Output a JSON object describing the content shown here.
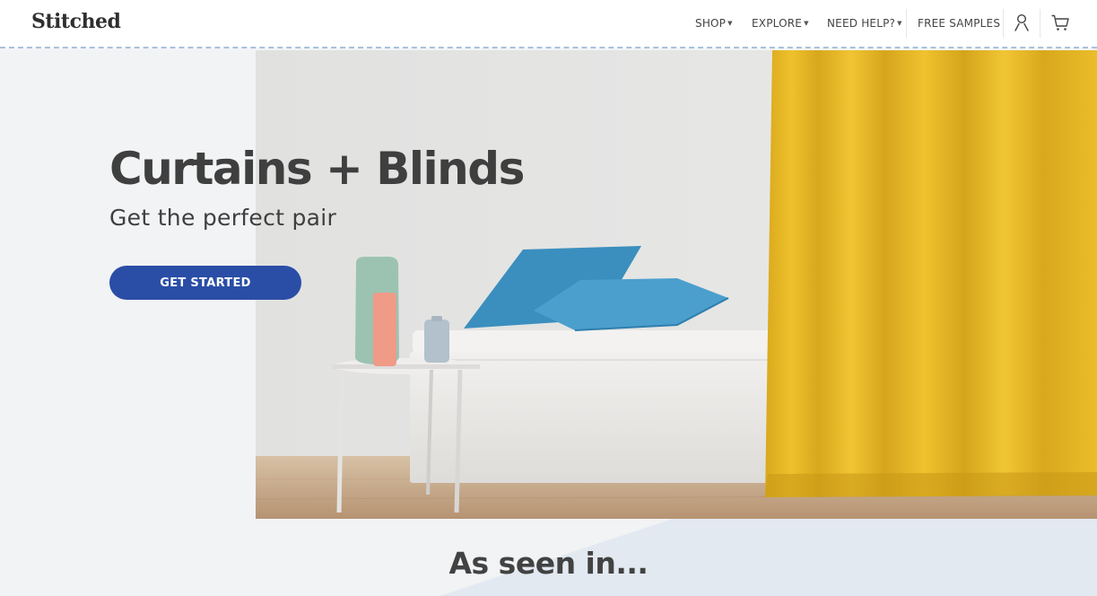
{
  "brand": {
    "logo": "Stitched"
  },
  "nav": {
    "shop": "SHOP",
    "explore": "EXPLORE",
    "need_help": "NEED HELP?",
    "free_samples": "FREE SAMPLES"
  },
  "icons": {
    "account": "user-icon",
    "cart": "cart-icon"
  },
  "hero": {
    "title": "Curtains + Blinds",
    "subtitle": "Get the perfect pair",
    "cta_label": "GET STARTED"
  },
  "section": {
    "title": "As seen in..."
  },
  "colors": {
    "accent": "#2a4ea6",
    "curtain": "#e8b826",
    "pillow": "#3f94c2",
    "dashed_border": "#a8c1dc",
    "page_bg": "#f2f3f5"
  }
}
